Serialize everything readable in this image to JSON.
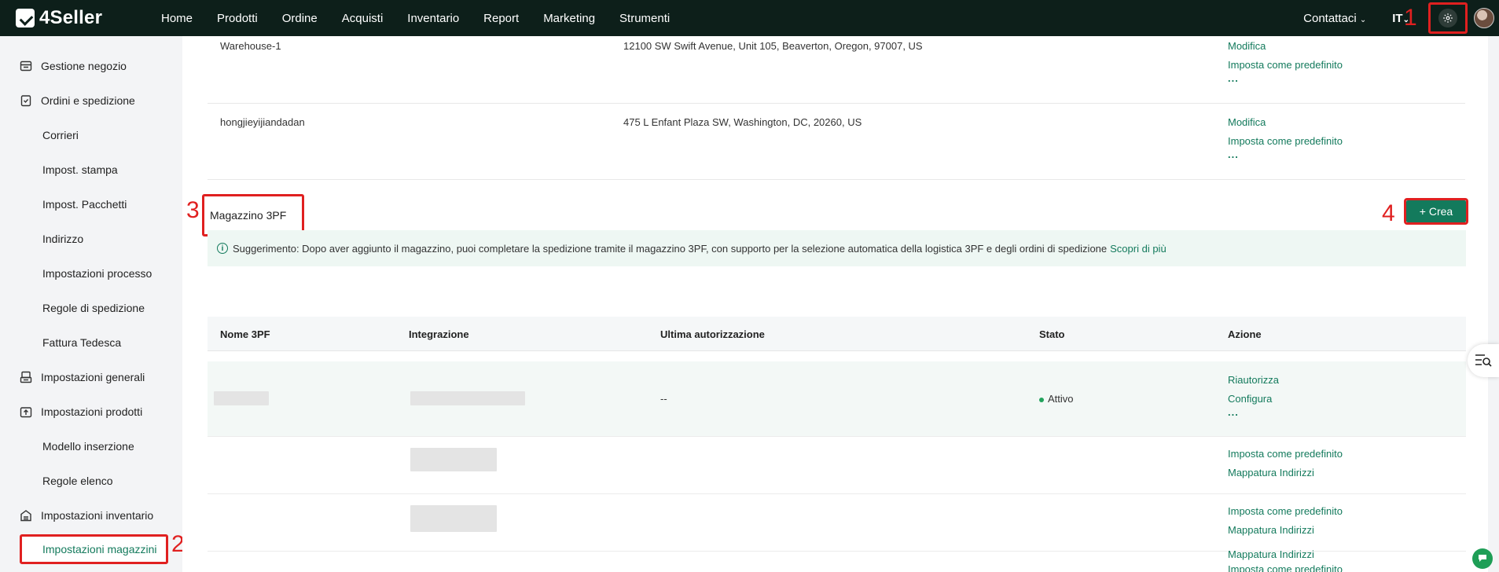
{
  "brand": {
    "name": "4Seller"
  },
  "nav": [
    "Home",
    "Prodotti",
    "Ordine",
    "Acquisti",
    "Inventario",
    "Report",
    "Marketing",
    "Strumenti"
  ],
  "header": {
    "contact": "Contattaci",
    "lang": "IT"
  },
  "annotations": {
    "a1": "1",
    "a2": "2",
    "a3": "3",
    "a4": "4"
  },
  "sidebar": {
    "items": [
      "Gestione negozio",
      "Ordini e spedizione",
      "Corrieri",
      "Impost. stampa",
      "Impost. Pacchetti",
      "Indirizzo",
      "Impostazioni processo",
      "Regole di spedizione",
      "Fattura Tedesca",
      "Impostazioni generali",
      "Impostazioni prodotti",
      "Modello inserzione",
      "Regole elenco",
      "Impostazioni inventario",
      "Impostazioni magazzini"
    ]
  },
  "warehouses": [
    {
      "name": "Warehouse-1",
      "address": "12100 SW Swift Avenue, Unit 105, Beaverton, Oregon, 97007, US",
      "action1": "Modifica",
      "action2": "Imposta come predefinito",
      "more": "..."
    },
    {
      "name": "hongjieyijiandadan",
      "address": "475 L Enfant Plaza SW, Washington, DC, 20260, US",
      "action1": "Modifica",
      "action2": "Imposta come predefinito",
      "more": "..."
    }
  ],
  "section3pf": {
    "title": "Magazzino 3PF",
    "create_label": "+ Crea",
    "tip": "Suggerimento: Dopo aver aggiunto il magazzino, puoi completare la spedizione tramite il magazzino 3PF, con supporto per la selezione automatica della logistica 3PF e degli ordini di spedizione",
    "tip_link": "Scopri di più",
    "columns": [
      "Nome 3PF",
      "Integrazione",
      "Ultima autorizzazione",
      "Stato",
      "Azione"
    ],
    "rows": [
      {
        "last_auth": "--",
        "status": "Attivo",
        "actions": [
          "Riautorizza",
          "Configura"
        ],
        "more": "..."
      },
      {
        "actions": [
          "Imposta come predefinito",
          "Mappatura Indirizzi"
        ]
      },
      {
        "actions": [
          "Imposta come predefinito",
          "Mappatura Indirizzi"
        ]
      },
      {
        "actions": [
          "Imposta come predefinito",
          "Mappatura Indirizzi"
        ]
      }
    ]
  },
  "colors": {
    "topbar": "#0d1f1a",
    "accent": "#137a5c",
    "annotation": "#e02020"
  }
}
